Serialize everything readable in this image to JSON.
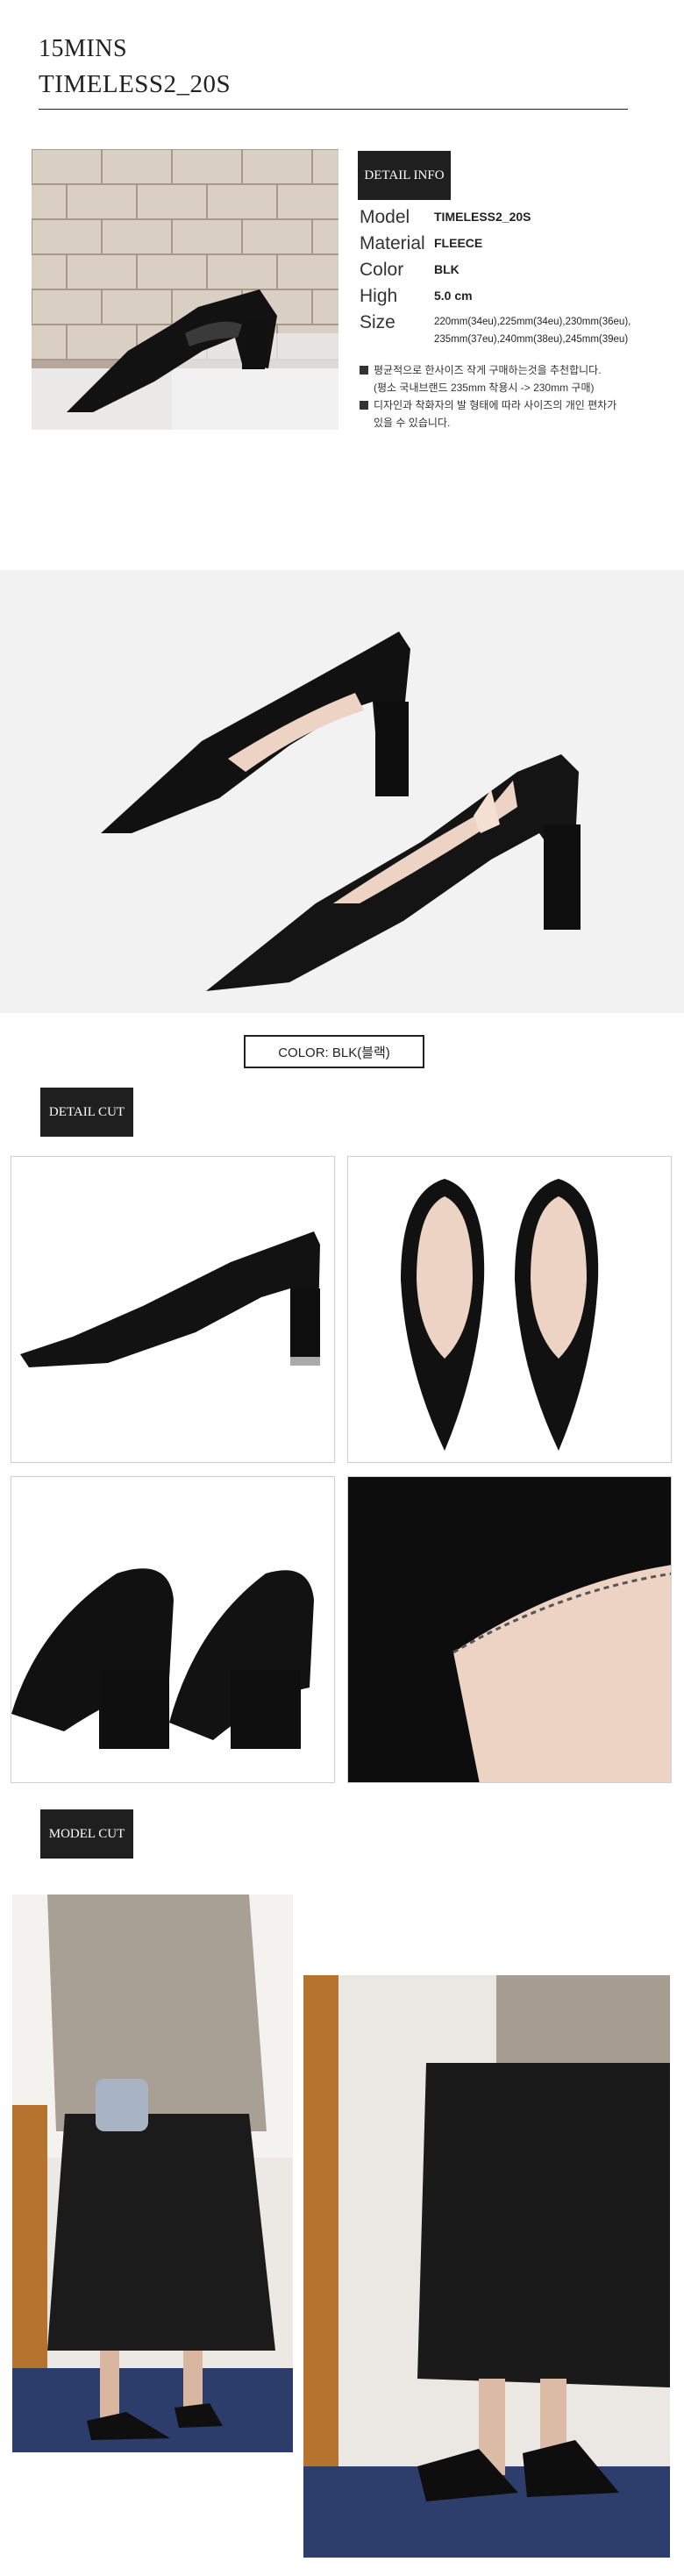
{
  "header": {
    "brand": "15MINS",
    "product_name": "TIMELESS2_20S"
  },
  "detail_info": {
    "badge": "DETAIL INFO",
    "rows": [
      {
        "label": "Model",
        "value": "TIMELESS2_20S"
      },
      {
        "label": "Material",
        "value": "FLEECE"
      },
      {
        "label": "Color",
        "value": "BLK"
      },
      {
        "label": "High",
        "value": "5.0 cm"
      },
      {
        "label": "Size",
        "value": "220mm(34eu),225mm(34eu),230mm(36eu),\n235mm(37eu),240mm(38eu),245mm(39eu)"
      }
    ],
    "notes": {
      "line1": "평균적으로 한사이즈 작게 구매하는것을 추천합니다.",
      "line1b": "(평소 국내브랜드 235mm 착용시 -> 230mm 구매)",
      "line2": "디자인과 착화자의 발 형태에 따라 사이즈의 개인 편차가",
      "line2b": "있을 수 있습니다."
    }
  },
  "color_label": "COLOR:  BLK(블랙)",
  "detail_cut": {
    "badge": "DETAIL CUT"
  },
  "model_cut": {
    "badge": "MODEL CUT"
  },
  "colors": {
    "badge_bg": "#1f1f1f",
    "suede": "#111111",
    "lining": "#ecd3c3",
    "photo_bg": "#f2f2f2"
  }
}
